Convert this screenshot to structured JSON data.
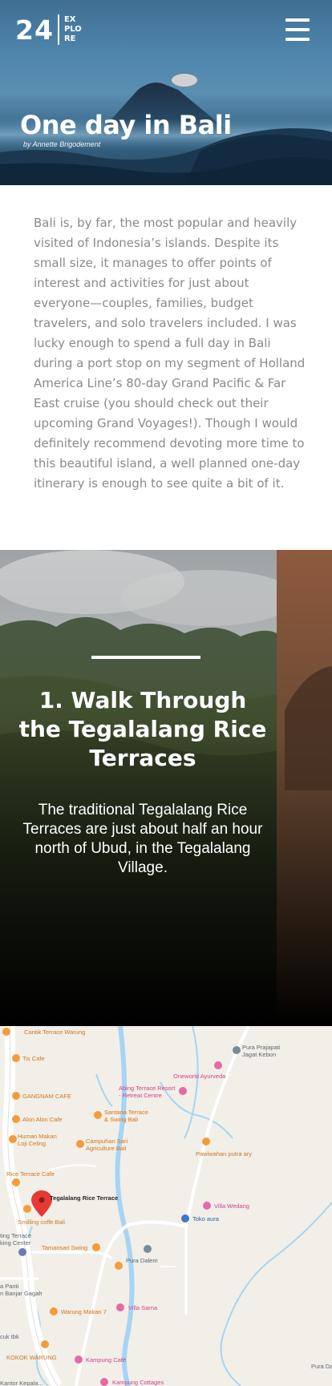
{
  "header": {
    "logo_number": "24",
    "logo_words": [
      "EX",
      "PLO",
      "RE"
    ],
    "menu_icon": "hamburger-icon"
  },
  "hero": {
    "title": "One day in Bali",
    "byline": "by Annette Brigodement"
  },
  "intro": {
    "text": "Bali is, by far, the most popular and heavily visited of Indonesia’s islands.  Despite its small size, it manages to offer points of interest and activities for just about everyone—couples, families, budget travelers, and solo travelers included. I was lucky enough to spend a full day in Bali during a port stop on my segment of Holland America Line’s 80-day Grand Pacific & Far East cruise (you should check out their upcoming Grand Voyages!). Though I would definitely recommend devoting more time to this beautiful island, a well planned one-day itinerary is enough to see quite a bit of it."
  },
  "feature": {
    "heading": "1. Walk Through the Tegalalang Rice Terraces",
    "text": "The traditional Tegalalang Rice Terraces are just about half an hour north of Ubud, in the Tegalalang Village."
  },
  "map": {
    "places": [
      {
        "label": "Cantik Terrace Warung",
        "kind": "orange"
      },
      {
        "label": "Tis Cafe",
        "kind": "orange"
      },
      {
        "label": "GANGNAM CAFE",
        "kind": "orange"
      },
      {
        "label": "Alon Alon Cafe",
        "kind": "orange"
      },
      {
        "label": "Human Makan\nLoji Celing",
        "kind": "orange"
      },
      {
        "label": "Rice Terrace Cafe",
        "kind": "orange"
      },
      {
        "label": "Tegalalang Rice Terrace",
        "kind": "red"
      },
      {
        "label": "Smilling coffe Bali",
        "kind": "orange"
      },
      {
        "label": "ting Terrace\nking Center",
        "kind": "gray"
      },
      {
        "label": "Tamansari Swing",
        "kind": "orange"
      },
      {
        "label": "a Panti\nn Banjar Gagah",
        "kind": "gray"
      },
      {
        "label": "Warung Makan 7",
        "kind": "orange"
      },
      {
        "label": "cuk tbk",
        "kind": "gray"
      },
      {
        "label": "KOKOK WARUNG",
        "kind": "orange"
      },
      {
        "label": "Kantor Kepala...",
        "kind": "gray"
      },
      {
        "label": "Santana Terrace\n& Swing Bali",
        "kind": "orange"
      },
      {
        "label": "Campuhan Sari\nAgriculture Bali",
        "kind": "orange"
      },
      {
        "label": "Abing Terrace Resort\n- Retreat Centre",
        "kind": "pink"
      },
      {
        "label": "Oneworld Ayurveda",
        "kind": "pink"
      },
      {
        "label": "Pura Prajapati\nJagat Kebon",
        "kind": "gray"
      },
      {
        "label": "Pawiwahan putra ary",
        "kind": "orange"
      },
      {
        "label": "Villa Wedang",
        "kind": "pink"
      },
      {
        "label": "Toko aura",
        "kind": "blue"
      },
      {
        "label": "Pura Dalem",
        "kind": "gray"
      },
      {
        "label": "Villa Sarna",
        "kind": "pink"
      },
      {
        "label": "Kampung Café",
        "kind": "pink"
      },
      {
        "label": "Kampung Cottages",
        "kind": "pink"
      },
      {
        "label": "Pura Da...",
        "kind": "gray"
      }
    ]
  },
  "colors": {
    "intro_text": "#8a8a8a",
    "poi_orange": "#d5741b",
    "poi_pink": "#d13f8b",
    "water": "#a7d4f2",
    "marker": "#e53935"
  }
}
